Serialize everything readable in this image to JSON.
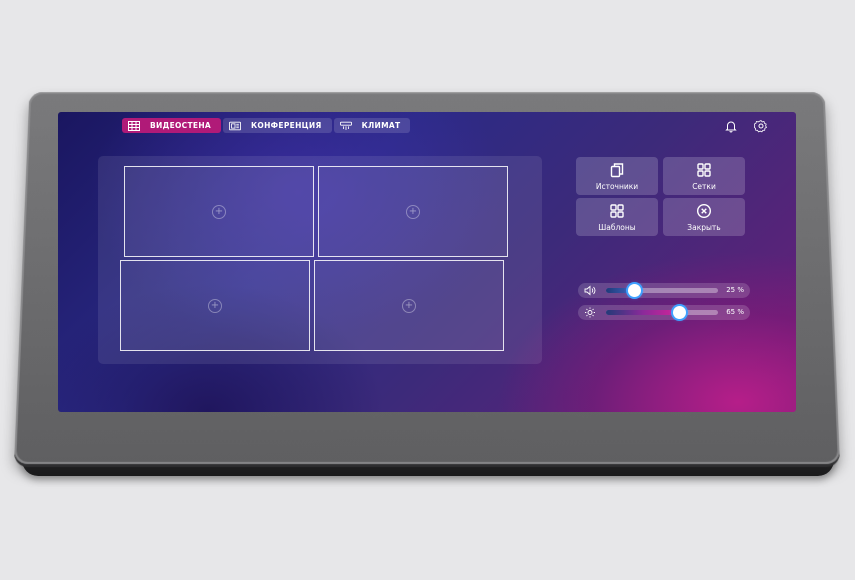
{
  "tabs": [
    {
      "label": "ВИДЕОСТЕНА",
      "icon": "grid-icon",
      "active": true
    },
    {
      "label": "КОНФЕРЕНЦИЯ",
      "icon": "conference-icon",
      "active": false
    },
    {
      "label": "КЛИМАТ",
      "icon": "climate-icon",
      "active": false
    }
  ],
  "top_icons": [
    "bell-icon",
    "settings-icon"
  ],
  "video_wall": {
    "cells": [
      "add-icon",
      "add-icon",
      "add-icon",
      "add-icon"
    ]
  },
  "controls": [
    {
      "label": "Источники",
      "icon": "sources-icon"
    },
    {
      "label": "Сетки",
      "icon": "grid-layout-icon"
    },
    {
      "label": "Шаблоны",
      "icon": "templates-icon"
    },
    {
      "label": "Закрыть",
      "icon": "close-icon"
    }
  ],
  "sliders": [
    {
      "icon": "volume-icon",
      "value": 25,
      "value_text": "25 %"
    },
    {
      "icon": "brightness-icon",
      "value": 65,
      "value_text": "65 %"
    }
  ],
  "colors": {
    "active_tab": "#b01a78",
    "accent_pink": "#c41e8c",
    "knob_glow": "#3fa0ff"
  }
}
